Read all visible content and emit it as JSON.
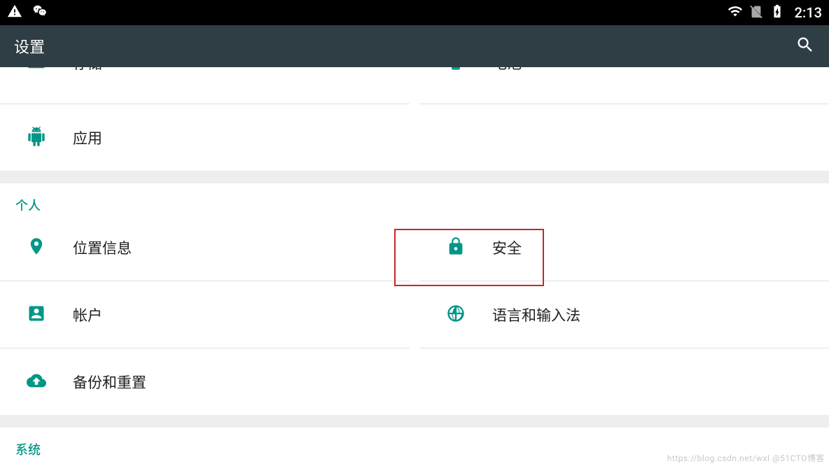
{
  "status": {
    "clock": "2:13"
  },
  "appbar": {
    "title": "设置"
  },
  "sections": {
    "device_partial": {
      "row0": {
        "left": {
          "label": "存储"
        },
        "right": {
          "label": "电池"
        }
      },
      "row1": {
        "left": {
          "label": "应用"
        }
      }
    },
    "personal": {
      "header": "个人",
      "row0": {
        "left": {
          "label": "位置信息"
        },
        "right": {
          "label": "安全"
        }
      },
      "row1": {
        "left": {
          "label": "帐户"
        },
        "right": {
          "label": "语言和输入法"
        }
      },
      "row2": {
        "left": {
          "label": "备份和重置"
        }
      }
    },
    "system": {
      "header": "系统"
    }
  },
  "watermark": "https://blog.csdn.net/wxl @51CTO博客"
}
